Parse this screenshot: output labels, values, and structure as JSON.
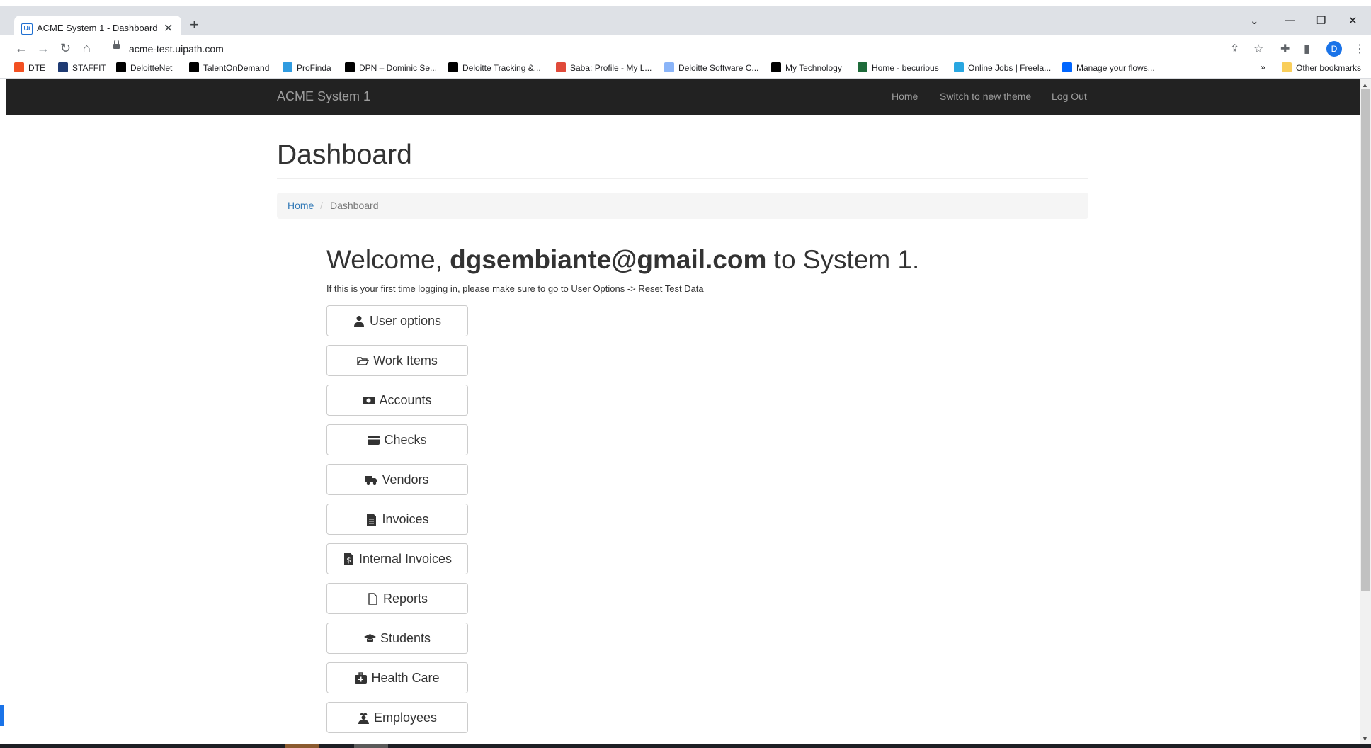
{
  "browser": {
    "tab_title": "ACME System 1 - Dashboard",
    "favicon_text": "Ui",
    "url": "acme-test.uipath.com",
    "profile_initial": "D",
    "bookmarks": [
      {
        "label": "DTE",
        "icon": "windows-tiles-icon",
        "color": "#f25022"
      },
      {
        "label": "STAFFIT",
        "icon": "staffit-icon",
        "color": "#1f3b73"
      },
      {
        "label": "DeloitteNet",
        "icon": "deloitte-d-icon",
        "color": "#000000"
      },
      {
        "label": "TalentOnDemand",
        "icon": "deloitte-d-icon",
        "color": "#000000"
      },
      {
        "label": "ProFinda",
        "icon": "profinda-icon",
        "color": "#2f9be0"
      },
      {
        "label": "DPN – Dominic Se...",
        "icon": "deloitte-d-icon",
        "color": "#000000"
      },
      {
        "label": "Deloitte Tracking &...",
        "icon": "deloitte-d-icon",
        "color": "#000000"
      },
      {
        "label": "Saba: Profile - My L...",
        "icon": "saba-icon",
        "color": "#e04a3a"
      },
      {
        "label": "Deloitte Software C...",
        "icon": "doc-icon",
        "color": "#8ab4f8"
      },
      {
        "label": "My Technology",
        "icon": "deloitte-d-icon",
        "color": "#000000"
      },
      {
        "label": "Home - becurious",
        "icon": "c-icon",
        "color": "#1e6b3a"
      },
      {
        "label": "Online Jobs | Freela...",
        "icon": "upwork-icon",
        "color": "#29a7e1"
      },
      {
        "label": "Manage your flows...",
        "icon": "flow-icon",
        "color": "#0066ff"
      }
    ],
    "overflow_chevron": "»",
    "other_bookmarks": "Other bookmarks"
  },
  "navbar": {
    "brand": "ACME System 1",
    "links": [
      "Home",
      "Switch to new theme",
      "Log Out"
    ]
  },
  "page": {
    "title": "Dashboard",
    "breadcrumb": {
      "home": "Home",
      "separator": "/",
      "current": "Dashboard"
    },
    "welcome_prefix": "Welcome, ",
    "welcome_user": "dgsembiante@gmail.com",
    "welcome_suffix": " to System 1.",
    "hint": "If this is your first time logging in, please make sure to go to User Options -> Reset Test Data"
  },
  "menu_buttons": [
    {
      "label": "User options",
      "icon": "user-icon"
    },
    {
      "label": "Work Items",
      "icon": "folder-open-icon"
    },
    {
      "label": "Accounts",
      "icon": "money-icon"
    },
    {
      "label": "Checks",
      "icon": "credit-card-icon"
    },
    {
      "label": "Vendors",
      "icon": "truck-icon"
    },
    {
      "label": "Invoices",
      "icon": "file-text-icon"
    },
    {
      "label": "Internal Invoices",
      "icon": "file-invoice-icon"
    },
    {
      "label": "Reports",
      "icon": "file-icon"
    },
    {
      "label": "Students",
      "icon": "graduation-cap-icon"
    },
    {
      "label": "Health Care",
      "icon": "medkit-icon"
    },
    {
      "label": "Employees",
      "icon": "user-secret-icon"
    }
  ],
  "colors": {
    "navbar_bg": "#222222",
    "link": "#337ab7",
    "brand_text": "#9d9d9d"
  }
}
